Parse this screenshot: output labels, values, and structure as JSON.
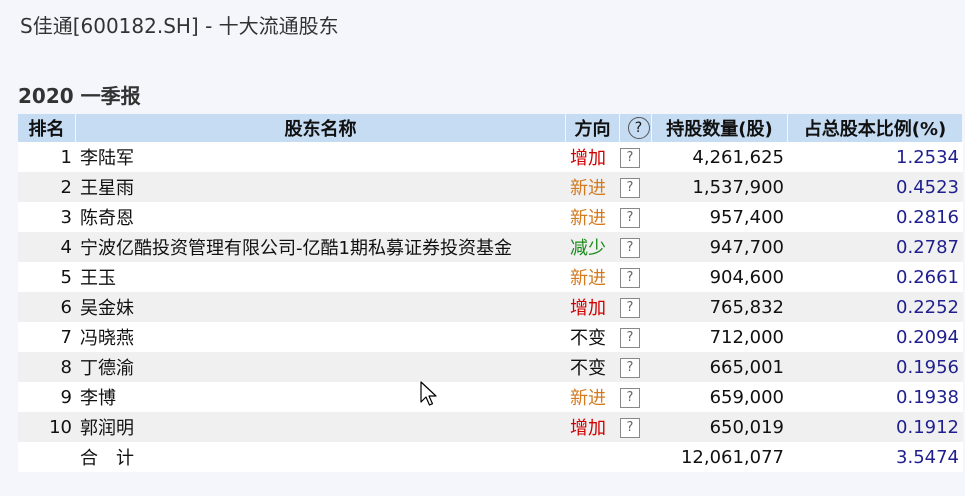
{
  "title": "S佳通[600182.SH] - 十大流通股东",
  "report_period": "2020 一季报",
  "colors": {
    "header_bg": "#c5dcf3",
    "increase": "#d10000",
    "new": "#d47a1f",
    "decrease": "#1a8a1a",
    "unchanged": "#111111",
    "ratio": "#1f1f8f"
  },
  "table": {
    "headers": {
      "rank": "排名",
      "name": "股东名称",
      "direction": "方向",
      "help": "?",
      "shares": "持股数量(股)",
      "ratio": "占总股本比例(%)"
    },
    "help_glyph": "?",
    "rows": [
      {
        "rank": "1",
        "name": "李陆军",
        "direction": "增加",
        "shares": "4,261,625",
        "ratio": "1.2534"
      },
      {
        "rank": "2",
        "name": "王星雨",
        "direction": "新进",
        "shares": "1,537,900",
        "ratio": "0.4523"
      },
      {
        "rank": "3",
        "name": "陈奇恩",
        "direction": "新进",
        "shares": "957,400",
        "ratio": "0.2816"
      },
      {
        "rank": "4",
        "name": "宁波亿酷投资管理有限公司-亿酷1期私募证券投资基金",
        "direction": "减少",
        "shares": "947,700",
        "ratio": "0.2787"
      },
      {
        "rank": "5",
        "name": "王玉",
        "direction": "新进",
        "shares": "904,600",
        "ratio": "0.2661"
      },
      {
        "rank": "6",
        "name": "吴金妹",
        "direction": "增加",
        "shares": "765,832",
        "ratio": "0.2252"
      },
      {
        "rank": "7",
        "name": "冯晓燕",
        "direction": "不变",
        "shares": "712,000",
        "ratio": "0.2094"
      },
      {
        "rank": "8",
        "name": "丁德渝",
        "direction": "不变",
        "shares": "665,001",
        "ratio": "0.1956"
      },
      {
        "rank": "9",
        "name": "李博",
        "direction": "新进",
        "shares": "659,000",
        "ratio": "0.1938"
      },
      {
        "rank": "10",
        "name": "郭润明",
        "direction": "增加",
        "shares": "650,019",
        "ratio": "0.1912"
      }
    ],
    "total": {
      "label": "合　计",
      "shares": "12,061,077",
      "ratio": "3.5474"
    }
  }
}
